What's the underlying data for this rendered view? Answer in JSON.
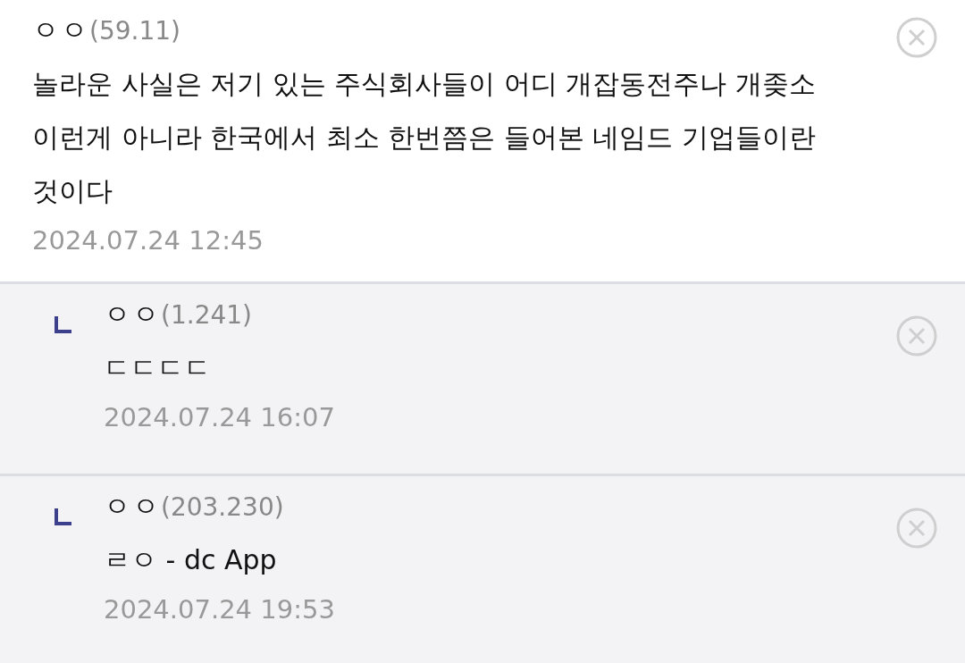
{
  "comments": [
    {
      "kind": "comment",
      "name": "ㅇㅇ",
      "ip": "(59.11)",
      "text": "놀라운 사실은 저기 있는 주식회사들이 어디 개잡동전주나 개좆소 이런게 아니라 한국에서 최소 한번쯤은 들어본 네임드 기업들이란 것이다",
      "date": "2024.07.24 12:45"
    },
    {
      "kind": "reply",
      "name": "ㅇㅇ",
      "ip": "(1.241)",
      "text": "ㄷㄷㄷㄷ",
      "date": "2024.07.24 16:07"
    },
    {
      "kind": "reply",
      "name": "ㅇㅇ",
      "ip": "(203.230)",
      "text": "ㄹㅇ - dc App",
      "date": "2024.07.24 19:53"
    }
  ]
}
